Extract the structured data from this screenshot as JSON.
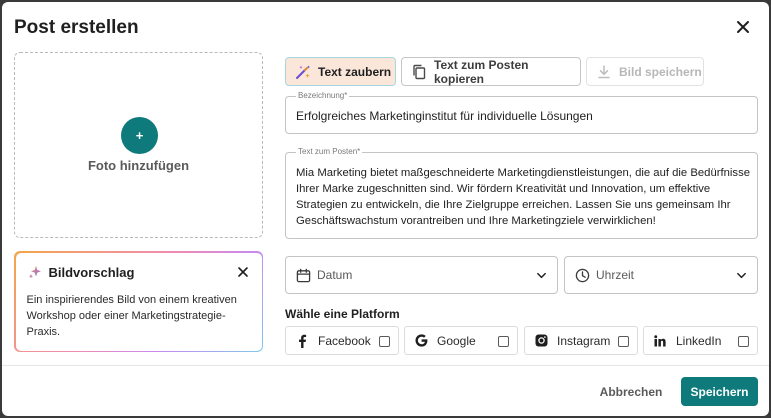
{
  "dialog": {
    "title": "Post erstellen"
  },
  "photo": {
    "add_label": "Foto hinzufügen",
    "plus_glyph": "+"
  },
  "suggestion": {
    "title": "Bildvorschlag",
    "text": "Ein inspirierendes Bild von einem kreativen Workshop oder einer Marketingstrategie-Praxis."
  },
  "toolbar": {
    "magic_label": "Text zaubern",
    "copy_label": "Text zum Posten kopieren",
    "save_image_label": "Bild speichern"
  },
  "form": {
    "name_label": "Bezeichnung*",
    "name_value": "Erfolgreiches Marketinginstitut für individuelle Lösungen",
    "text_label": "Text zum Posten*",
    "text_value": "Mia Marketing bietet maßgeschneiderte Marketingdienstleistungen, die auf die Bedürfnisse Ihrer Marke zugeschnitten sind. Wir fördern Kreativität und Innovation, um effektive Strategien zu entwickeln, die Ihre Zielgruppe erreichen. Lassen Sie uns gemeinsam Ihr Geschäftswachstum vorantreiben und Ihre Marketingziele verwirklichen!",
    "date_placeholder": "Datum",
    "time_placeholder": "Uhrzeit"
  },
  "platforms": {
    "title": "Wähle eine Platform",
    "items": [
      {
        "label": "Facebook",
        "icon": "facebook-icon",
        "checked": false
      },
      {
        "label": "Google",
        "icon": "google-icon",
        "checked": false
      },
      {
        "label": "Instagram",
        "icon": "instagram-icon",
        "checked": false
      },
      {
        "label": "LinkedIn",
        "icon": "linkedin-icon",
        "checked": false
      }
    ]
  },
  "footer": {
    "cancel_label": "Abbrechen",
    "save_label": "Speichern"
  },
  "colors": {
    "primary": "#0f7a7c",
    "magic_bg": "#fbe6da",
    "magic_border": "#a6d6e1"
  }
}
